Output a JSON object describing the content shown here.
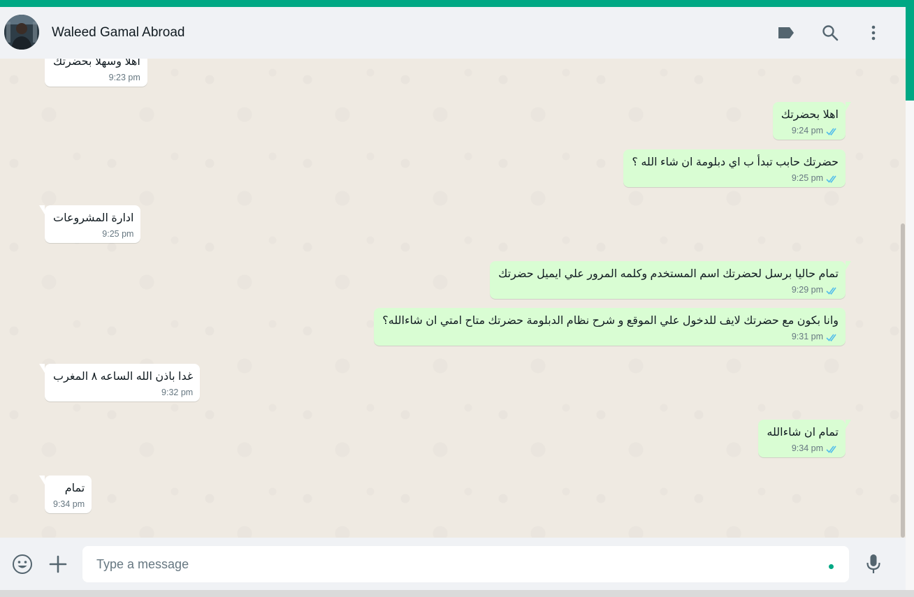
{
  "header": {
    "contact_name": "Waleed Gamal Abroad",
    "icons": [
      "label-icon",
      "search-icon",
      "menu-icon"
    ]
  },
  "messages": [
    {
      "direction": "in",
      "text": "اهلا وسهلا بحضرتك",
      "time": "9:23 pm"
    },
    {
      "direction": "out",
      "text": "اهلا بحضرتك",
      "time": "9:24 pm"
    },
    {
      "direction": "out",
      "text": "حضرتك حابب تبدأ ب اي دبلومة ان شاء الله ؟",
      "time": "9:25 pm"
    },
    {
      "direction": "in",
      "text": "ادارة المشروعات",
      "time": "9:25 pm"
    },
    {
      "direction": "out",
      "text": "تمام حاليا برسل لحضرتك اسم المستخدم وكلمه المرور علي ايميل حضرتك",
      "time": "9:29 pm"
    },
    {
      "direction": "out",
      "text": "وانا بكون مع حضرتك لايف للدخول علي الموقع و شرح نظام الدبلومة حضرتك متاح امتي ان شاءالله؟",
      "time": "9:31 pm"
    },
    {
      "direction": "in",
      "text": "غدا باذن الله الساعه ٨ المغرب",
      "time": "9:32 pm"
    },
    {
      "direction": "out",
      "text": "تمام ان شاءالله",
      "time": "9:34 pm"
    },
    {
      "direction": "in",
      "text": "تمام",
      "time": "9:34 pm"
    }
  ],
  "composer": {
    "placeholder": "Type a message",
    "icons": [
      "emoji-icon",
      "attach-plus-icon",
      "microphone-icon"
    ]
  },
  "colors": {
    "accent": "#00a884",
    "outgoing_bubble": "#d9fdd3",
    "incoming_bubble": "#ffffff",
    "read_ticks": "#53bdeb"
  }
}
